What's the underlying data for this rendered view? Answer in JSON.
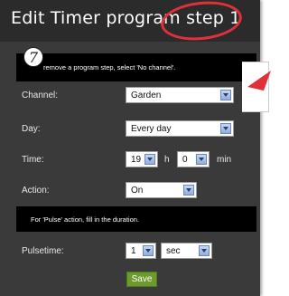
{
  "dialog": {
    "title": "Edit Timer program step 1"
  },
  "step_badge": "7",
  "info_top": "remove a program step, select 'No channel'.",
  "info_pulse": "For 'Pulse' action, fill in the duration.",
  "form": {
    "channel": {
      "label": "Channel:",
      "value": "Garden"
    },
    "day": {
      "label": "Day:",
      "value": "Every day"
    },
    "time": {
      "label": "Time:",
      "hour": "19",
      "hour_unit": "h",
      "minute": "0",
      "minute_unit": "min"
    },
    "action": {
      "label": "Action:",
      "value": "On"
    },
    "pulsetime": {
      "label": "Pulsetime:",
      "value": "1",
      "unit": "sec"
    }
  },
  "save_label": "Save",
  "colors": {
    "panel": "#3a3a3a",
    "annotation": "#e0303a",
    "save": "#6d9a2d"
  }
}
